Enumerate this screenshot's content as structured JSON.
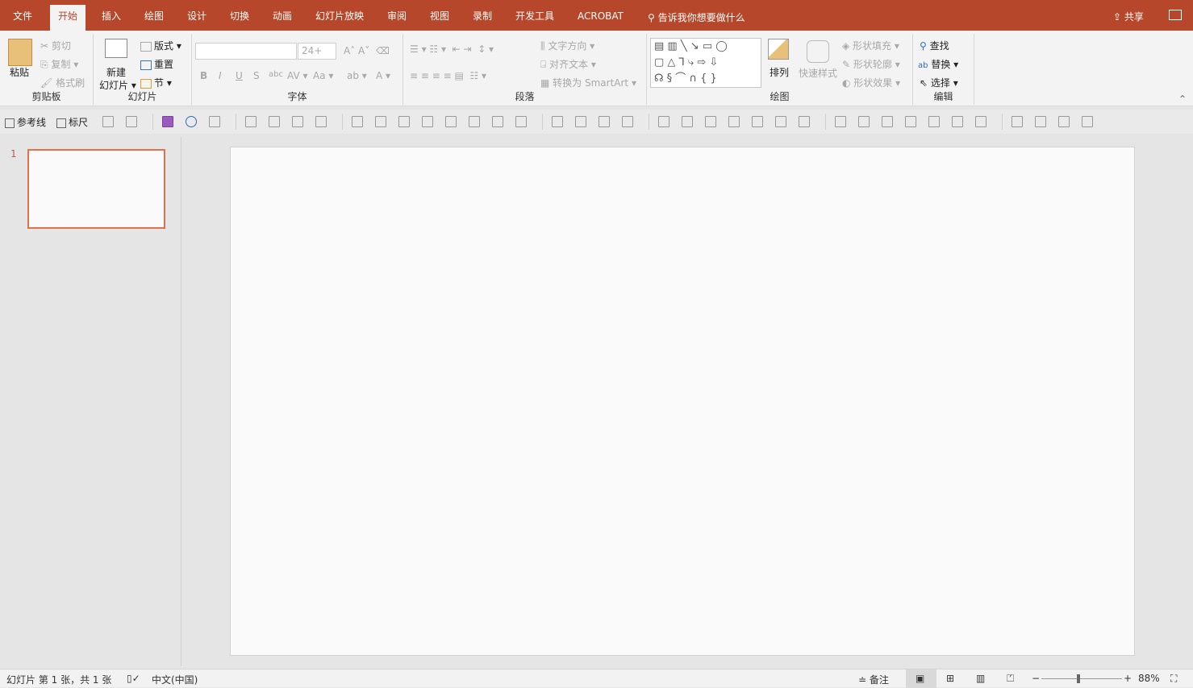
{
  "tabs": [
    "文件",
    "开始",
    "插入",
    "绘图",
    "设计",
    "切换",
    "动画",
    "幻灯片放映",
    "审阅",
    "视图",
    "录制",
    "开发工具",
    "ACROBAT"
  ],
  "active_tab": "开始",
  "tell_me": "告诉我你想要做什么",
  "share": "共享",
  "ribbon": {
    "clipboard": {
      "paste": "粘贴",
      "cut": "剪切",
      "copy": "复制",
      "format_painter": "格式刷",
      "label": "剪贴板"
    },
    "slides": {
      "new_slide_1": "新建",
      "new_slide_2": "幻灯片",
      "layout": "版式",
      "reset": "重置",
      "section": "节",
      "label": "幻灯片"
    },
    "font": {
      "font_name": "",
      "font_size": "24+",
      "bold": "B",
      "italic": "I",
      "underline": "U",
      "shadow": "S",
      "strike": "abc",
      "spacing": "AV",
      "case": "Aa",
      "color": "A",
      "label": "字体"
    },
    "paragraph": {
      "text_direction": "文字方向",
      "align_text": "对齐文本",
      "smartart": "转换为 SmartArt",
      "label": "段落"
    },
    "drawing": {
      "arrange": "排列",
      "quick_styles": "快速样式",
      "shape_fill": "形状填充",
      "shape_outline": "形状轮廓",
      "shape_effects": "形状效果",
      "label": "绘图"
    },
    "editing": {
      "find": "查找",
      "replace": "替换",
      "select": "选择",
      "label": "编辑"
    }
  },
  "qat": {
    "guides": "参考线",
    "ruler": "标尺",
    "icons": [
      "gridlines-icon",
      "close-box-icon",
      "|",
      "save-icon",
      "undo-icon",
      "present-icon",
      "|",
      "animation-icon",
      "screen-icon",
      "char-spacing-icon",
      "line-spacing-icon",
      "|",
      "align-bottom-icon",
      "align-top-icon",
      "align-left-icon",
      "align-right-icon",
      "align-center-icon",
      "align-middle-icon",
      "distribute-h-icon",
      "distribute-v-icon",
      "|",
      "group-icon",
      "bring-forward-icon",
      "send-backward-icon",
      "ungroup-icon",
      "|",
      "merge-shapes-icon",
      "edit-shape-icon",
      "rectangle-icon",
      "rounded-rect-icon",
      "oval-icon",
      "triangle-icon",
      "format-painter-icon",
      "|",
      "eyedropper-icon",
      "eyedropper-icon",
      "fill-icon",
      "textbox-icon",
      "font-color-icon",
      "pen-icon",
      "highlighter-icon",
      "|",
      "pin-icon",
      "crop-fit-icon",
      "crop-icon",
      "more-icon"
    ]
  },
  "slides": {
    "number": "1"
  },
  "status": {
    "slide_info": "幻灯片 第 1 张，共 1 张",
    "language": "中文(中国)",
    "notes": "备注",
    "zoom": "88%",
    "zoom_level": 88
  },
  "colors": {
    "accent": "#B7472A",
    "thumb_border": "#E0714A"
  }
}
